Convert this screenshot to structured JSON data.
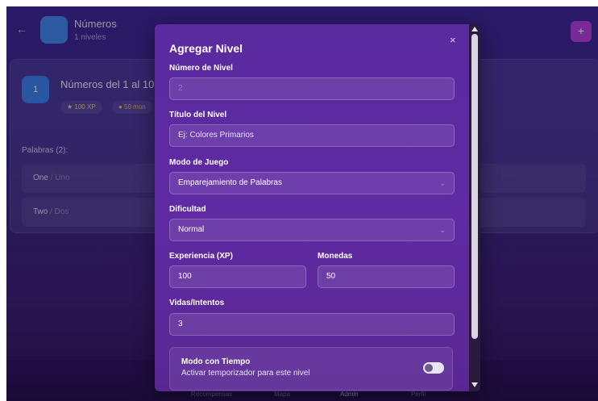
{
  "header": {
    "back_icon": "←",
    "title": "Números",
    "subtitle": "1 niveles",
    "add_icon": "+"
  },
  "level": {
    "number": "1",
    "title": "Números del 1 al 10",
    "xp_badge": "★ 100 XP",
    "coins_badge": "● 50 mon",
    "words_label": "Palabras (2):",
    "words": [
      {
        "en": "One",
        "es": " / Uno"
      },
      {
        "en": "Two",
        "es": " / Dos"
      }
    ]
  },
  "bottom_nav": {
    "items": [
      "Recompensas",
      "Mapa",
      "Admin",
      "Perfil"
    ]
  },
  "modal": {
    "title": "Agregar Nivel",
    "close_icon": "×",
    "level_number_label": "Número de Nivel",
    "level_number_value": "2",
    "level_title_label": "Título del Nivel",
    "level_title_placeholder": "Ej: Colores Primarios",
    "mode_label": "Modo de Juego",
    "mode_value": "Emparejamiento de Palabras",
    "difficulty_label": "Dificultad",
    "difficulty_value": "Normal",
    "xp_label": "Experiencia (XP)",
    "xp_value": "100",
    "coins_label": "Monedas",
    "coins_value": "50",
    "lives_label": "Vidas/Intentos",
    "lives_value": "3",
    "timer_title": "Modo con Tiempo",
    "timer_subtitle": "Activar temporizador para este nivel",
    "timer_enabled": false
  },
  "colors": {
    "accent": "#b43fd8",
    "modal_bg": "#5f2aa3",
    "app_bg": "#3d2590",
    "level_badge": "#3b82e8"
  }
}
